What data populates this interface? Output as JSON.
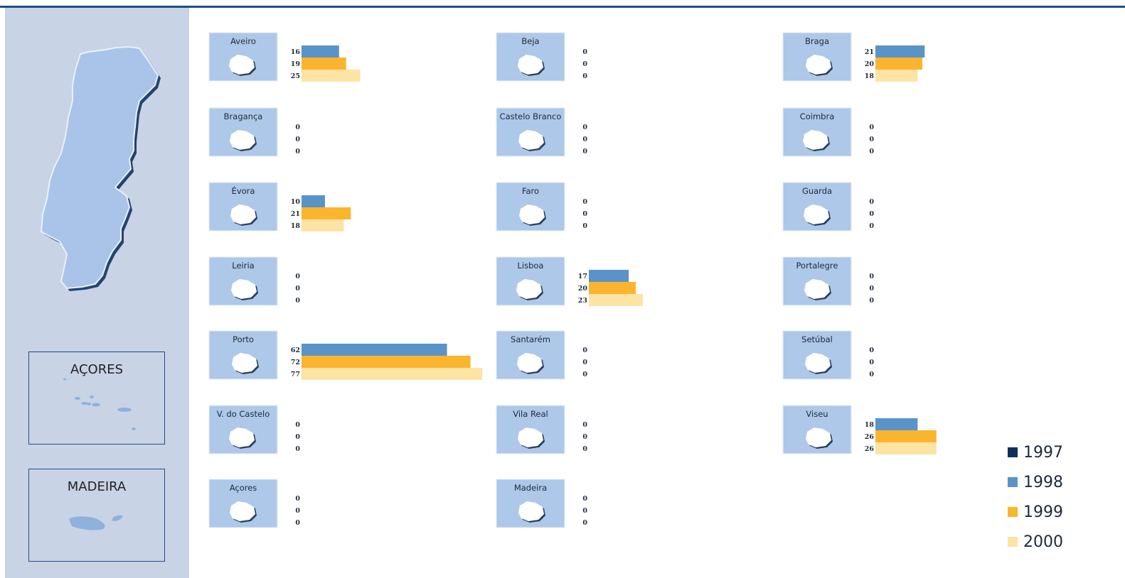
{
  "inset_labels": {
    "acores": "AÇORES",
    "madeira": "MADEIRA"
  },
  "chart_data": {
    "type": "bar",
    "orientation": "horizontal",
    "series_names": [
      "1997",
      "1998",
      "1999",
      "2000"
    ],
    "colors": {
      "1997": "#0e2f5a",
      "1998": "#5a93c8",
      "1999": "#fbb42e",
      "2000": "#fde3a4"
    },
    "districts": [
      {
        "name": "Aveiro",
        "values": [
          16,
          19,
          25
        ]
      },
      {
        "name": "Beja",
        "values": [
          0,
          0,
          0
        ]
      },
      {
        "name": "Braga",
        "values": [
          21,
          20,
          18
        ]
      },
      {
        "name": "Bragança",
        "values": [
          0,
          0,
          0
        ]
      },
      {
        "name": "Castelo Branco",
        "values": [
          0,
          0,
          0
        ]
      },
      {
        "name": "Coimbra",
        "values": [
          0,
          0,
          0
        ]
      },
      {
        "name": "Évora",
        "values": [
          10,
          21,
          18
        ]
      },
      {
        "name": "Faro",
        "values": [
          0,
          0,
          0
        ]
      },
      {
        "name": "Guarda",
        "values": [
          0,
          0,
          0
        ]
      },
      {
        "name": "Leiria",
        "values": [
          0,
          0,
          0
        ]
      },
      {
        "name": "Lisboa",
        "values": [
          17,
          20,
          23
        ]
      },
      {
        "name": "Portalegre",
        "values": [
          0,
          0,
          0
        ]
      },
      {
        "name": "Porto",
        "values": [
          62,
          72,
          77
        ]
      },
      {
        "name": "Santarém",
        "values": [
          0,
          0,
          0
        ]
      },
      {
        "name": "Setúbal",
        "values": [
          0,
          0,
          0
        ]
      },
      {
        "name": "V. do Castelo",
        "values": [
          0,
          0,
          0
        ]
      },
      {
        "name": "Vila Real",
        "values": [
          0,
          0,
          0
        ]
      },
      {
        "name": "Viseu",
        "values": [
          18,
          26,
          26
        ]
      },
      {
        "name": "Açores",
        "values": [
          0,
          0,
          0
        ]
      },
      {
        "name": "Madeira",
        "values": [
          0,
          0,
          0
        ]
      }
    ]
  }
}
